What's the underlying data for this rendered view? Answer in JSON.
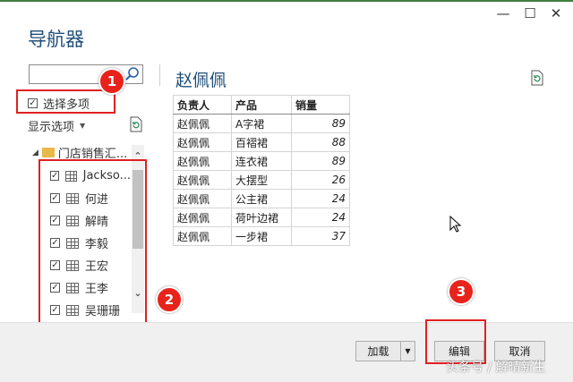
{
  "window": {
    "title": "导航器",
    "minimize_glyph": "—",
    "maximize_glyph": "☐",
    "close_glyph": "✕"
  },
  "left_panel": {
    "search_placeholder": "",
    "multi_select_label": "选择多项",
    "multi_select_checked": true,
    "display_options_label": "显示选项",
    "folder_label": "门店销售汇...",
    "items": [
      {
        "label": "Jackso...",
        "checked": true
      },
      {
        "label": "何进",
        "checked": true
      },
      {
        "label": "解晴",
        "checked": true
      },
      {
        "label": "李毅",
        "checked": true
      },
      {
        "label": "王宏",
        "checked": true
      },
      {
        "label": "王李",
        "checked": true
      },
      {
        "label": "吴珊珊",
        "checked": true
      }
    ]
  },
  "preview": {
    "title": "赵佩佩",
    "columns": [
      "负责人",
      "产品",
      "销量"
    ],
    "rows": [
      [
        "赵佩佩",
        "A字裙",
        "89"
      ],
      [
        "赵佩佩",
        "百褶裙",
        "88"
      ],
      [
        "赵佩佩",
        "连衣裙",
        "89"
      ],
      [
        "赵佩佩",
        "大摆型",
        "26"
      ],
      [
        "赵佩佩",
        "公主裙",
        "24"
      ],
      [
        "赵佩佩",
        "荷叶边裙",
        "24"
      ],
      [
        "赵佩佩",
        "一步裙",
        "37"
      ]
    ]
  },
  "footer": {
    "load_label": "加载",
    "edit_label": "编辑",
    "cancel_label": "取消"
  },
  "annotations": {
    "badge1": "1",
    "badge2": "2",
    "badge3": "3",
    "watermark": "头条号 / 解晴新生"
  },
  "colors": {
    "accent_title": "#1f4e79",
    "annotation_red": "#e02020",
    "folder": "#e8b84a"
  }
}
